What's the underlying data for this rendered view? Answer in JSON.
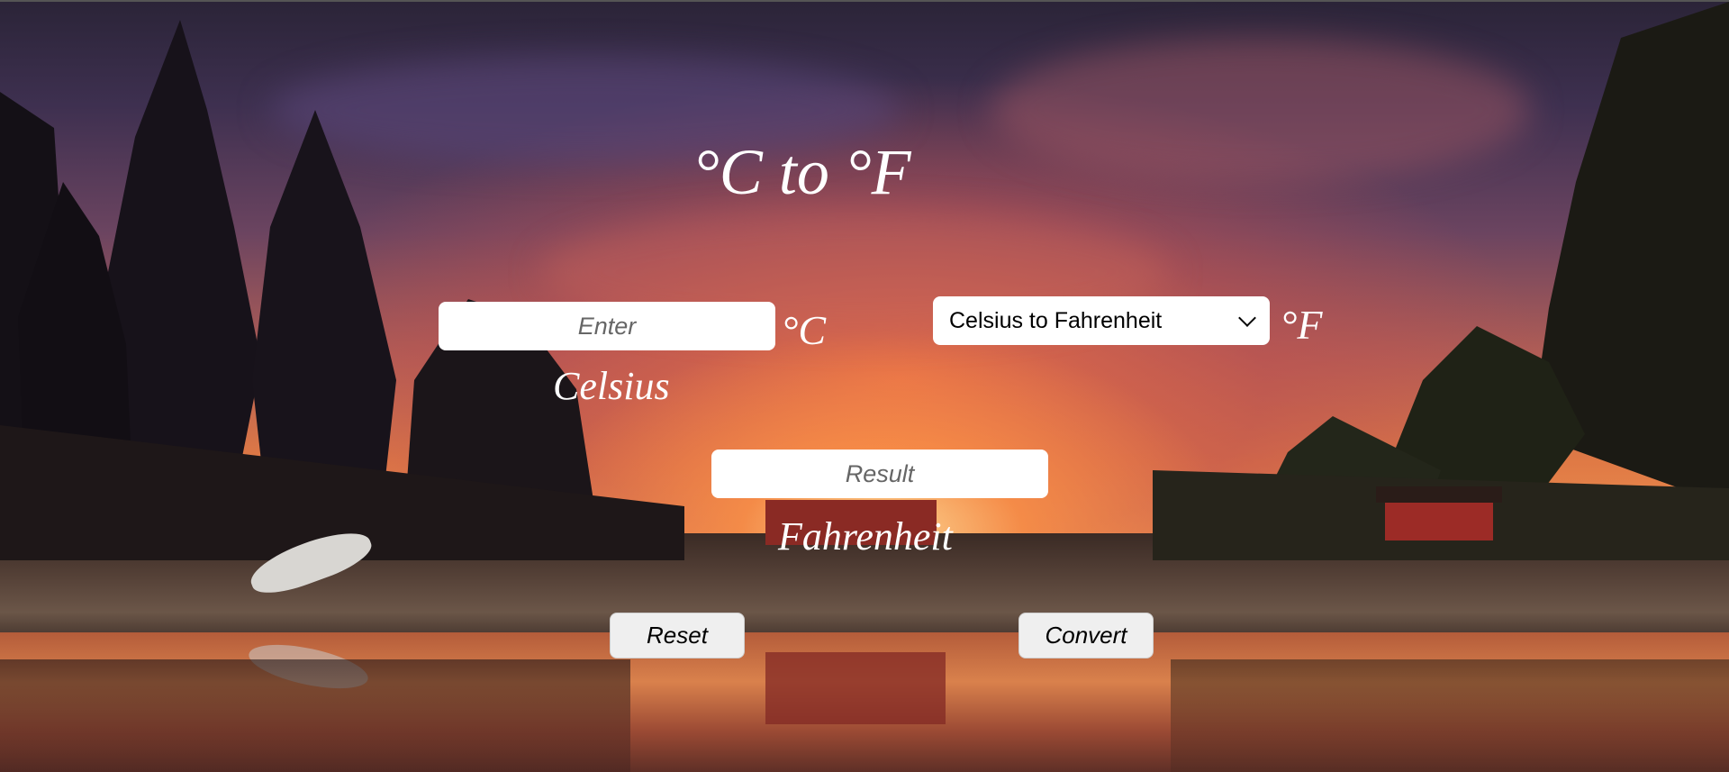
{
  "title": "°C to °F",
  "input": {
    "placeholder": "Enter",
    "unit": "°C",
    "caption": "Celsius"
  },
  "conversion_select": {
    "selected": "Celsius to Fahrenheit",
    "unit": "°F"
  },
  "result": {
    "placeholder": "Result",
    "caption": "Fahrenheit"
  },
  "buttons": {
    "reset_label": "Reset",
    "convert_label": "Convert"
  },
  "colors": {
    "text": "#ffffff",
    "field_background": "#ffffff",
    "button_background": "#efefef"
  },
  "background": "sunset-lake-landscape-photo"
}
